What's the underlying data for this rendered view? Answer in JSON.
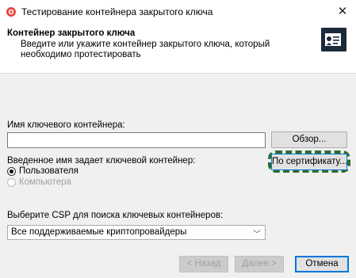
{
  "window": {
    "title": "Тестирование контейнера закрытого ключа"
  },
  "header": {
    "title": "Контейнер закрытого ключа",
    "description": "Введите или укажите контейнер закрытого ключа, который необходимо протестировать"
  },
  "container": {
    "name_label": "Имя ключевого контейнера:",
    "name_value": "",
    "browse_label": "Обзор...",
    "by_certificate_label": "По сертификату..."
  },
  "key_scope": {
    "label": "Введенное имя задает ключевой контейнер:",
    "options": [
      {
        "label": "Пользователя",
        "checked": true,
        "enabled": true
      },
      {
        "label": "Компьютера",
        "checked": false,
        "enabled": false
      }
    ]
  },
  "csp": {
    "label": "Выберите CSP для поиска ключевых контейнеров:",
    "selected": "Все поддерживаемые криптопровайдеры"
  },
  "footer": {
    "back_label": "< Назад",
    "next_label": "Далее >",
    "cancel_label": "Отмена"
  },
  "colors": {
    "highlight": "#2f6b2a",
    "accent": "#0078d7"
  },
  "icons": {
    "app": "certificate-app-icon",
    "header": "certificate-card-icon",
    "close": "close-icon",
    "dropdown": "chevron-down-icon"
  }
}
